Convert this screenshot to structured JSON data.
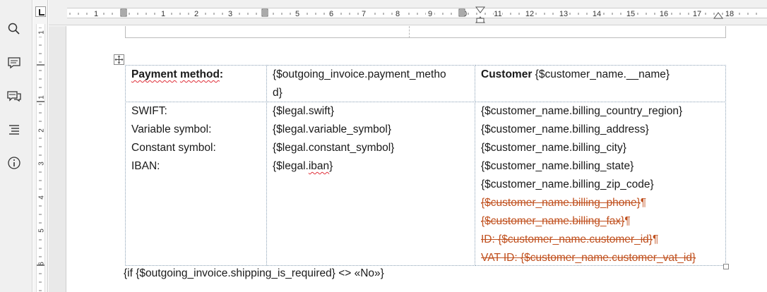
{
  "sidebar": {
    "items": [
      {
        "icon": "search-icon"
      },
      {
        "icon": "comment-icon"
      },
      {
        "icon": "chat-icon"
      },
      {
        "icon": "navigator-icon"
      },
      {
        "icon": "info-icon"
      }
    ]
  },
  "hruler": {
    "labels": [
      "1",
      "1",
      "2",
      "3",
      "4",
      "5",
      "6",
      "7",
      "8",
      "9",
      "10",
      "11",
      "12",
      "13",
      "14",
      "15",
      "16",
      "17",
      "18"
    ]
  },
  "vruler": {
    "labels": [
      "1",
      "1",
      "2",
      "3",
      "4",
      "5",
      "6"
    ]
  },
  "table": {
    "header": {
      "col1_bold_a": "Payment",
      "col1_bold_b": "method",
      "col1_colon": ":",
      "col2_line1": "{$outgoing_invoice.payment_metho",
      "col2_line2": "d}",
      "col3_bold": "Customer",
      "col3_rest": " {$customer_name.__name}"
    },
    "labels": [
      "SWIFT:",
      "Variable symbol:",
      "Constant symbol:",
      "IBAN:"
    ],
    "legal": [
      "{$legal.swift}",
      "{$legal.variable_symbol}",
      "{$legal.constant_symbol}"
    ],
    "iban_prefix": "{$legal.",
    "iban_word": "iban",
    "iban_suffix": "}",
    "customer": [
      "{$customer_name.billing_country_region}",
      "{$customer_name.billing_address}",
      "{$customer_name.billing_city}",
      "{$customer_name.billing_state}",
      "{$customer_name.billing_zip_code}"
    ],
    "deleted": [
      "{$customer_name.billing_phone}",
      "{$customer_name.billing_fax}",
      "ID: {$customer_name.customer_id}",
      "VAT ID: {$customer_name.customer_vat_id}"
    ],
    "pilcrow": "¶"
  },
  "after_table": "{if {$outgoing_invoice.shipping_is_required} <> «No»}",
  "colors": {
    "tracked_deletion": "#c0501e",
    "spellcheck": "#e0303a",
    "cell_border": "#8aa0b5"
  }
}
